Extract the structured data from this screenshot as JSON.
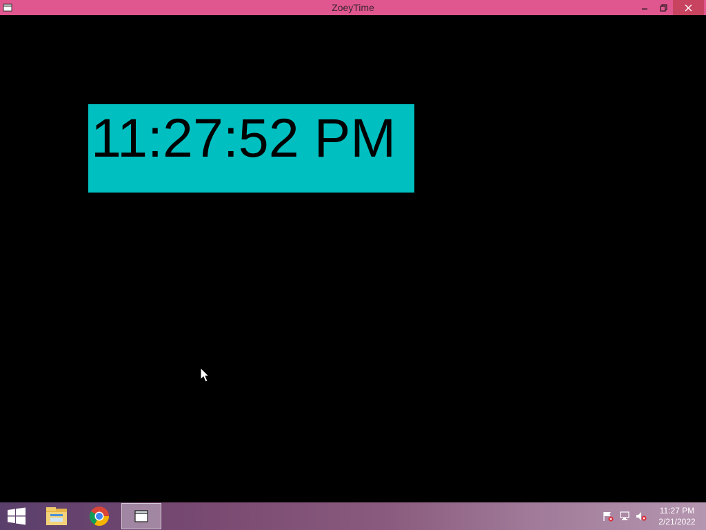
{
  "window": {
    "title": "ZoeyTime",
    "app_icon": "window-app-icon",
    "controls": {
      "minimize_icon": "minimize-icon",
      "maximize_icon": "restore-icon",
      "close_icon": "close-icon"
    }
  },
  "clock": {
    "time": "11:27:52 PM",
    "background_color": "#00bfc0",
    "text_color": "#000000"
  },
  "taskbar": {
    "start_icon": "windows-start-icon",
    "pinned": [
      {
        "name": "file-explorer-icon"
      },
      {
        "name": "chrome-icon"
      },
      {
        "name": "zoeytime-app-icon",
        "active": true
      }
    ],
    "tray": {
      "icons": [
        "action-center-flag-icon",
        "network-icon",
        "volume-muted-icon"
      ],
      "time": "11:27 PM",
      "date": "2/21/2022"
    }
  },
  "colors": {
    "titlebar": "#e0578f",
    "desktop": "#000000"
  }
}
